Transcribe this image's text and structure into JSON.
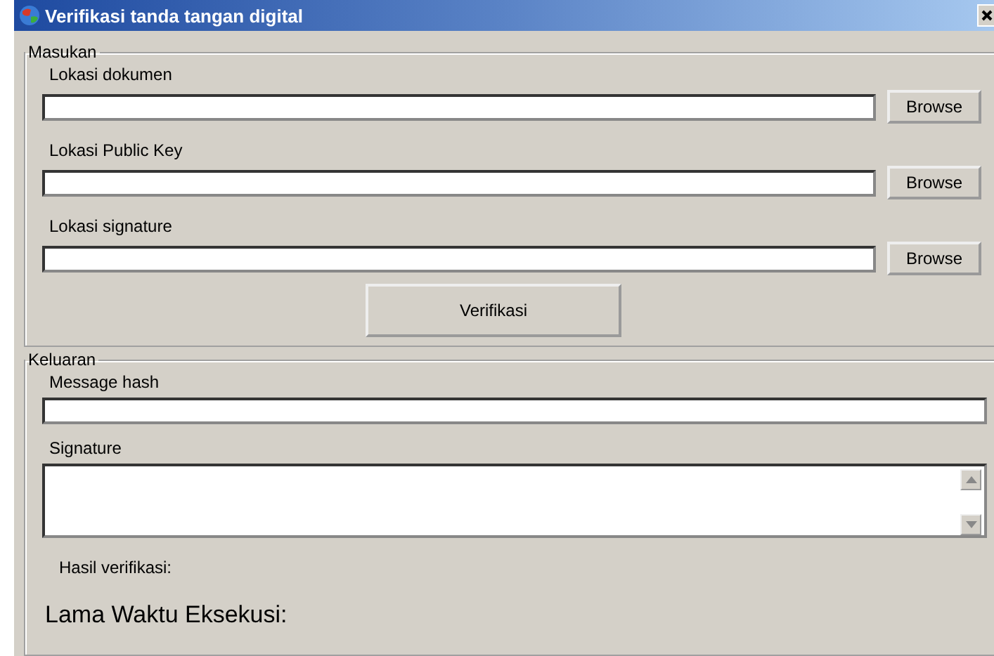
{
  "window": {
    "title": "Verifikasi tanda tangan digital"
  },
  "input_group": {
    "title": "Masukan",
    "fields": [
      {
        "label": "Lokasi dokumen",
        "button": "Browse"
      },
      {
        "label": "Lokasi Public Key",
        "button": "Browse"
      },
      {
        "label": "Lokasi signature",
        "button": "Browse"
      }
    ],
    "action_button": "Verifikasi"
  },
  "output_group": {
    "title": "Keluaran",
    "hash_label": "Message hash",
    "signature_label": "Signature",
    "result_label": "Hasil verifikasi:",
    "time_label": "Lama Waktu Eksekusi:"
  }
}
